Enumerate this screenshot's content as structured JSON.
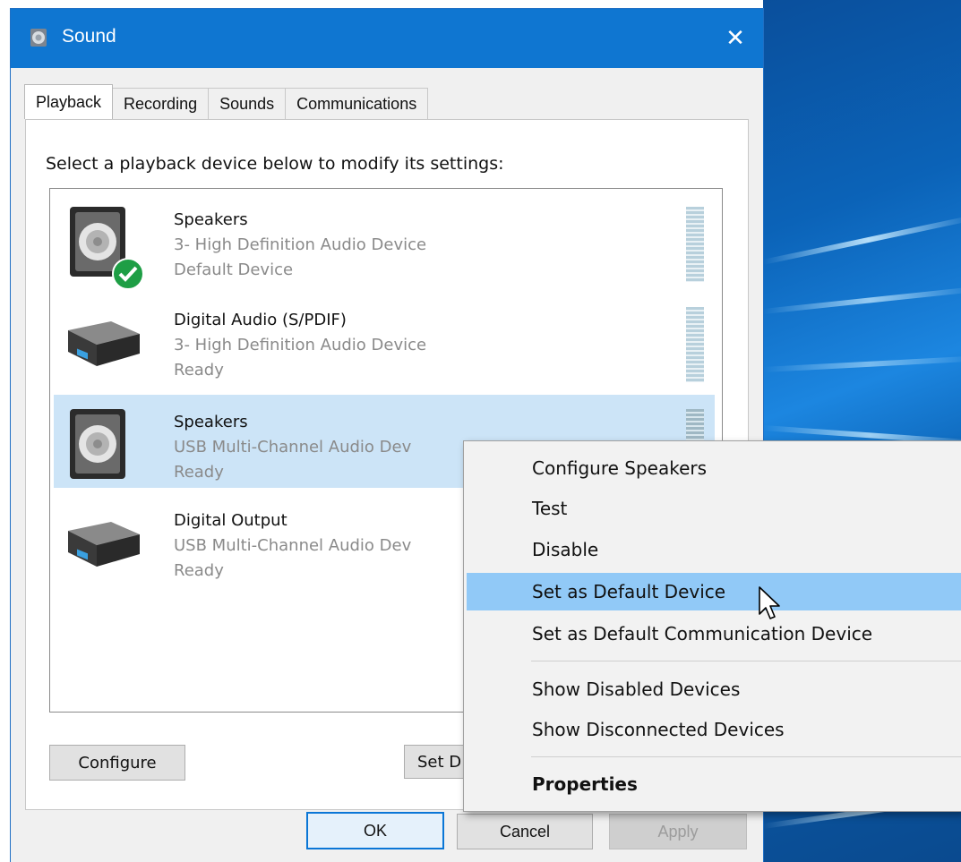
{
  "window": {
    "title": "Sound",
    "close_glyph": "✕",
    "tabs": [
      {
        "label": "Playback",
        "active": true
      },
      {
        "label": "Recording",
        "active": false
      },
      {
        "label": "Sounds",
        "active": false
      },
      {
        "label": "Communications",
        "active": false
      }
    ]
  },
  "playback": {
    "instruction": "Select a playback device below to modify its settings:",
    "devices": [
      {
        "name": "Speakers",
        "description": "3- High Definition Audio Device",
        "status": "Default Device",
        "icon": "speaker-icon",
        "is_default": true,
        "selected": false
      },
      {
        "name": "Digital Audio (S/PDIF)",
        "description": "3- High Definition Audio Device",
        "status": "Ready",
        "icon": "digital-output-icon",
        "is_default": false,
        "selected": false
      },
      {
        "name": "Speakers",
        "description": "USB Multi-Channel Audio Dev",
        "status": "Ready",
        "icon": "speaker-icon",
        "is_default": false,
        "selected": true
      },
      {
        "name": "Digital Output",
        "description": "USB Multi-Channel Audio Dev",
        "status": "Ready",
        "icon": "digital-output-icon",
        "is_default": false,
        "selected": false
      }
    ],
    "configure_label": "Configure",
    "set_default_label": "Set D"
  },
  "footer": {
    "ok_label": "OK",
    "cancel_label": "Cancel",
    "apply_label": "Apply"
  },
  "context_menu": {
    "items": [
      {
        "label": "Configure Speakers",
        "highlighted": false,
        "bold": false
      },
      {
        "label": "Test",
        "highlighted": false,
        "bold": false
      },
      {
        "label": "Disable",
        "highlighted": false,
        "bold": false
      },
      {
        "label": "Set as Default Device",
        "highlighted": true,
        "bold": false
      },
      {
        "label": "Set as Default Communication Device",
        "highlighted": false,
        "bold": false
      },
      {
        "label": "Show Disabled Devices",
        "highlighted": false,
        "bold": false
      },
      {
        "label": "Show Disconnected Devices",
        "highlighted": false,
        "bold": false
      },
      {
        "label": "Properties",
        "highlighted": false,
        "bold": true
      }
    ]
  },
  "colors": {
    "titlebar": "#0f76d1",
    "selection": "#cce4f7",
    "menu_highlight": "#91c9f7",
    "default_check": "#1e9e45"
  }
}
